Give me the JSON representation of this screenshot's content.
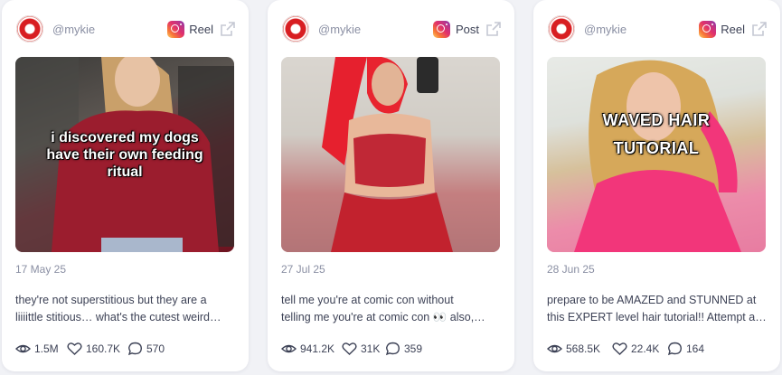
{
  "posts": [
    {
      "handle": "@mykie",
      "type_label": "Reel",
      "media_overlay_text": "i discovered my dogs have their own feeding ritual",
      "date": "17 May 25",
      "caption_line1": "they're not superstitious but they are a",
      "caption_line2": "liiiittle stitious… what's the cutest weird…",
      "views": "1.5M",
      "likes": "160.7K",
      "comments": "570"
    },
    {
      "handle": "@mykie",
      "type_label": "Post",
      "media_overlay_text": "",
      "date": "27 Jul 25",
      "caption_line1": "tell me you're at comic con without",
      "caption_line2": "telling me you're at comic con 👀 also,…",
      "views": "941.2K",
      "likes": "31K",
      "comments": "359"
    },
    {
      "handle": "@mykie",
      "type_label": "Reel",
      "media_overlay_text": "WAVED HAIR TUTORIAL",
      "date": "28 Jun 25",
      "caption_line1": "prepare to be AMAZED and STUNNED at",
      "caption_line2": "this EXPERT level hair tutorial!! Attempt a…",
      "views": "568.5K",
      "likes": "22.4K",
      "comments": "164"
    }
  ],
  "icons": {
    "platform": "instagram-icon",
    "external": "external-link-icon",
    "views": "eye-icon",
    "likes": "heart-icon",
    "comments": "comment-icon"
  },
  "colors": {
    "card_bg": "#ffffff",
    "page_bg": "#f1f2f6",
    "muted_text": "#8a8fa3",
    "body_text": "#3d4256"
  }
}
